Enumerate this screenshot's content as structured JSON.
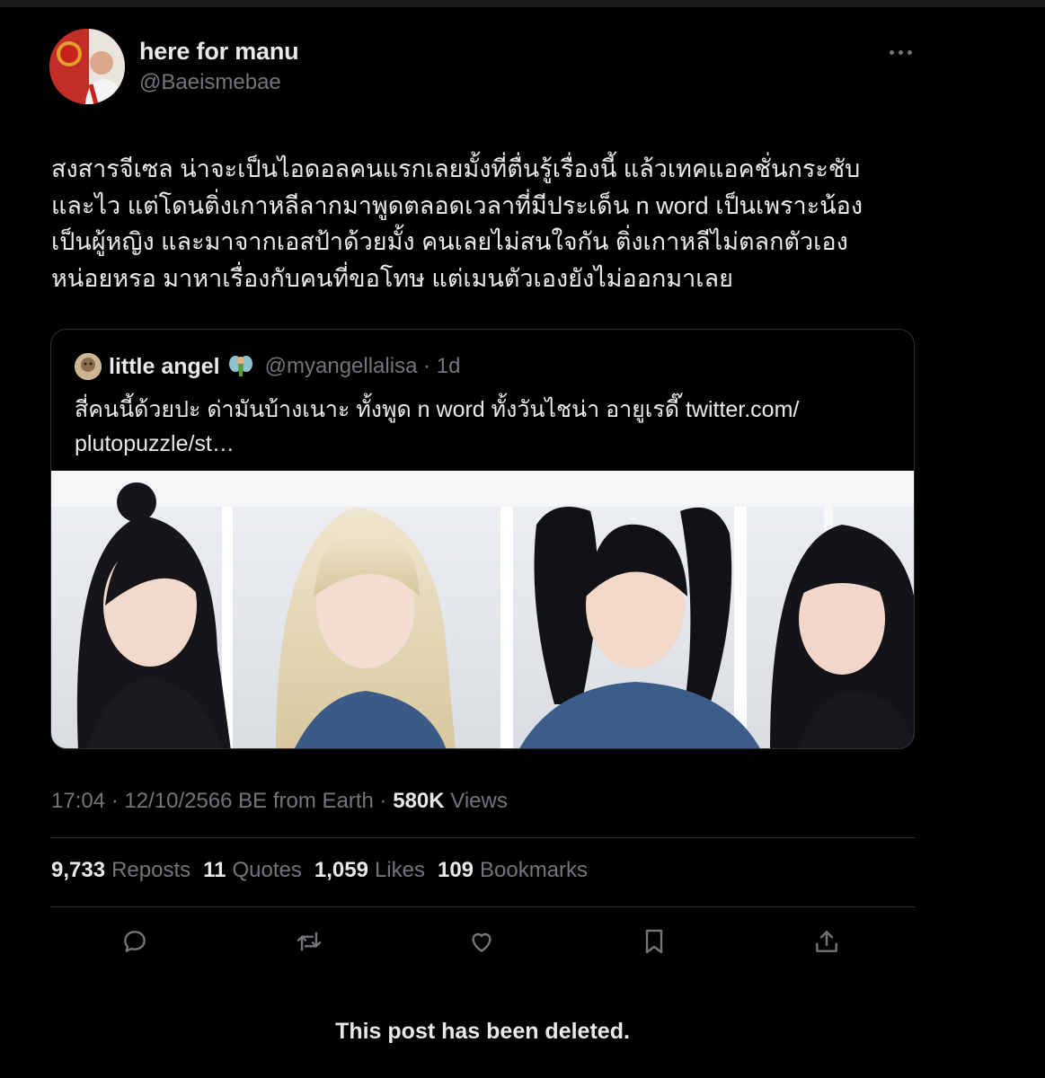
{
  "author": {
    "display_name": "here for manu",
    "handle": "@Baeismebae"
  },
  "tweet": {
    "text": "สงสารจีเซล น่าจะเป็นไอดอลคนแรกเลยมั้งที่ตื่นรู้เรื่องนี้ แล้วเทคแอคชั่นกระชับ\nและไว แต่โดนติ่งเกาหลีลากมาพูดตลอดเวลาที่มีประเด็น n word เป็นเพราะน้อง\nเป็นผู้หญิง และมาจากเอสป้าด้วยมั้ง คนเลยไม่สนใจกัน ติ่งเกาหลีไม่ตลกตัวเอง\nหน่อยหรอ มาหาเรื่องกับคนที่ขอโทษ แต่เมนตัวเองยังไม่ออกมาเลย"
  },
  "quoted": {
    "display_name": "little angel",
    "emoji": "🧚",
    "handle_time": "@myangellalisa · 1d",
    "text": "สี่คนนี้ด้วยปะ ด่ามันบ้างเนาะ ทั้งพูด n word ทั้งวันไชน่า อายูเรดี๊ twitter.com/\nplutopuzzle/st…"
  },
  "meta": {
    "time_date": "17:04 · 12/10/2566 BE from Earth · ",
    "views_count": "580K",
    "views_label": " Views"
  },
  "stats": [
    {
      "count": "9,733",
      "label": "Reposts"
    },
    {
      "count": "11",
      "label": "Quotes"
    },
    {
      "count": "1,059",
      "label": "Likes"
    },
    {
      "count": "109",
      "label": "Bookmarks"
    }
  ],
  "notice": "This post has been deleted.",
  "icons": [
    "reply-icon",
    "repost-icon",
    "like-icon",
    "bookmark-icon",
    "share-icon",
    "more-icon"
  ],
  "colors": {
    "background": "#000000",
    "text": "#e7e9ea",
    "secondary": "#71767b",
    "border": "#2f3336"
  }
}
